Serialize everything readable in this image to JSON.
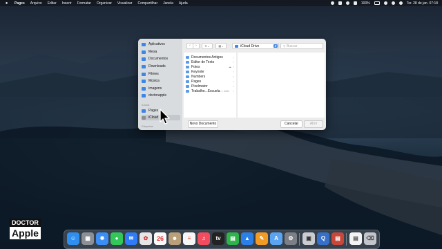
{
  "menubar": {
    "app": "Pages",
    "items": [
      "Arquivo",
      "Editar",
      "Inserir",
      "Formatar",
      "Organizar",
      "Visualizar",
      "Compartilhar",
      "Janela",
      "Ajuda"
    ],
    "battery": "100%",
    "clock": "Ter. 28 de jan.  07:18"
  },
  "dialog": {
    "sidebar": {
      "items": [
        "Aplicativos",
        "Mesa",
        "Documentos",
        "Downloads",
        "Filmes",
        "Música",
        "Imagens",
        "doctorapple"
      ],
      "icloud_header": "iCloud",
      "icloud_items": [
        "Pages",
        "iCloud"
      ],
      "locations_header": "Etiquetas"
    },
    "location": "iCloud Drive",
    "search_placeholder": "Buscar",
    "files": [
      {
        "name": "Documentos Antigos",
        "extra": ""
      },
      {
        "name": "Editor de Texto",
        "extra": ""
      },
      {
        "name": "Fotos",
        "extra": "☁"
      },
      {
        "name": "Keynote",
        "extra": ""
      },
      {
        "name": "Numbers",
        "extra": ""
      },
      {
        "name": "Pages",
        "extra": ""
      },
      {
        "name": "Pixelmator",
        "extra": ""
      },
      {
        "name": "Trabalho...Escuela",
        "extra": "...l. Helfe"
      }
    ],
    "buttons": {
      "new_document": "Novo Documento",
      "cancel": "Cancelar",
      "open": "Abrir"
    }
  },
  "logo": {
    "line1": "DOCTOR",
    "line2": "Apple"
  },
  "colors": {
    "accent": "#3b86e6",
    "sidebar": "#d9dcdf",
    "dialog": "#ececec"
  }
}
